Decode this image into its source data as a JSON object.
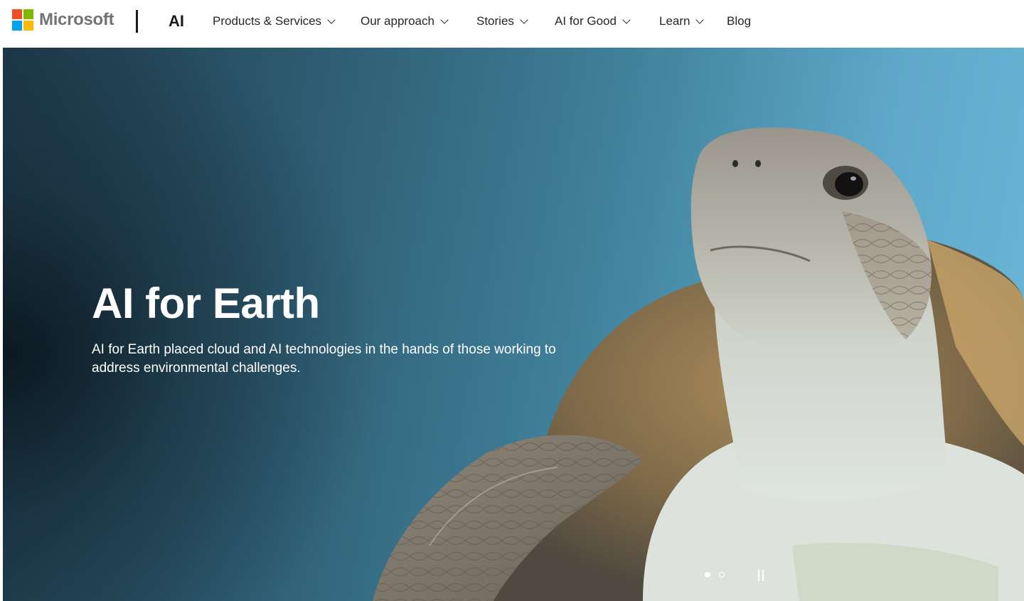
{
  "header": {
    "brand": "Microsoft",
    "site_name": "AI",
    "nav": [
      {
        "label": "Products & Services",
        "has_dropdown": true
      },
      {
        "label": "Our approach",
        "has_dropdown": true
      },
      {
        "label": "Stories",
        "has_dropdown": true
      },
      {
        "label": "AI for Good",
        "has_dropdown": true
      },
      {
        "label": "Learn",
        "has_dropdown": true
      },
      {
        "label": "Blog",
        "has_dropdown": false
      }
    ],
    "logo_colors": [
      "#f25022",
      "#7fba00",
      "#00a4ef",
      "#ffb900"
    ]
  },
  "hero": {
    "title": "AI for Earth",
    "description": "AI for Earth placed cloud and AI technologies in the hands of those working to address environmental challenges.",
    "image_subject": "sea-turtle",
    "carousel": {
      "slide_count": 2,
      "active_index": 0,
      "control": "pause"
    }
  }
}
